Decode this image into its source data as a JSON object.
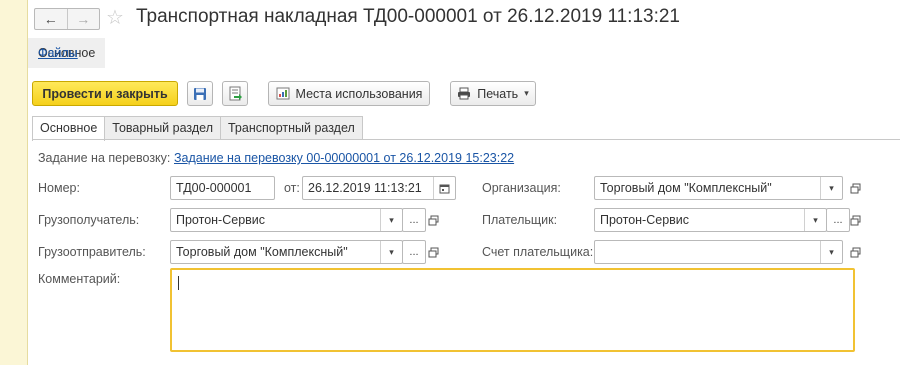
{
  "window": {
    "title": "Транспортная накладная ТД00-000001 от 26.12.2019 11:13:21",
    "nav_back": "←",
    "nav_forward": "→",
    "favorite": "☆"
  },
  "panel_tabs": [
    {
      "label": "Основное",
      "active": true
    },
    {
      "label": "Файлы",
      "active": false
    }
  ],
  "toolbar": {
    "post_close_label": "Провести и закрыть",
    "usage_label": "Места использования",
    "print_label": "Печать"
  },
  "form_tabs": [
    {
      "label": "Основное",
      "active": true
    },
    {
      "label": "Товарный раздел",
      "active": false
    },
    {
      "label": "Транспортный раздел",
      "active": false
    }
  ],
  "form": {
    "task_label": "Задание на перевозку:",
    "task_link": "Задание на перевозку 00-00000001 от 26.12.2019 15:23:22",
    "number_label": "Номер:",
    "number_value": "ТД00-000001",
    "date_label": "от:",
    "date_value": "26.12.2019 11:13:21",
    "organization_label": "Организация:",
    "organization_value": "Торговый дом \"Комплексный\"",
    "consignee_label": "Грузополучатель:",
    "consignee_value": "Протон-Сервис",
    "payer_label": "Плательщик:",
    "payer_value": "Протон-Сервис",
    "shipper_label": "Грузоотправитель:",
    "shipper_value": "Торговый дом \"Комплексный\"",
    "payer_account_label": "Счет плательщика:",
    "payer_account_value": "",
    "comment_label": "Комментарий:",
    "comment_value": ""
  },
  "icons": {
    "dropdown": "▾",
    "choose": "..."
  },
  "colors": {
    "primary_button": "#f5d01b",
    "link": "#1a55a5",
    "focus_border": "#f1c232"
  }
}
